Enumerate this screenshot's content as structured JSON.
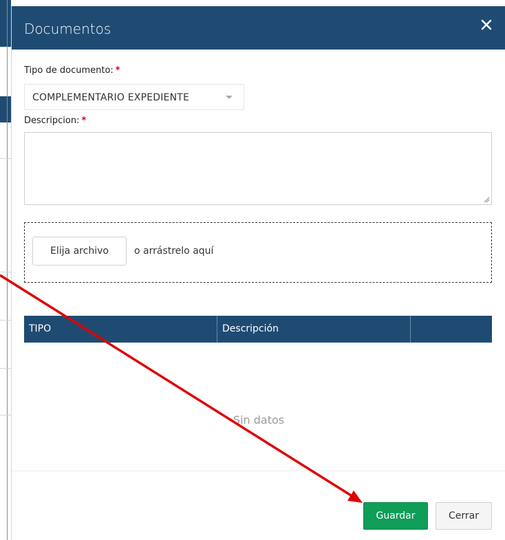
{
  "modal": {
    "title": "Documentos",
    "close_icon": "close-icon"
  },
  "form": {
    "tipo_label": "Tipo de documento:",
    "tipo_required": "*",
    "tipo_value": "COMPLEMENTARIO EXPEDIENTE",
    "descripcion_label": "Descripcion:",
    "descripcion_required": "*",
    "descripcion_value": ""
  },
  "upload": {
    "button_label": "Elija archivo",
    "drop_text": "o arrástrelo aquí"
  },
  "table": {
    "columns": [
      "TIPO",
      "Descripción",
      ""
    ],
    "empty_text": "Sin datos"
  },
  "footer": {
    "save_label": "Guardar",
    "close_label": "Cerrar"
  },
  "colors": {
    "header": "#1f4b73",
    "save_button": "#0f9d58",
    "required": "#d0021b",
    "annotation_arrow": "#e00000"
  }
}
